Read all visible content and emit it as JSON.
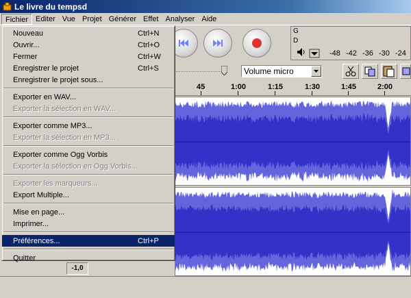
{
  "window": {
    "title": "Le livre du tempsd"
  },
  "menubar": {
    "items": [
      "Fichier",
      "Editer",
      "Vue",
      "Projet",
      "Générer",
      "Effet",
      "Analyser",
      "Aide"
    ]
  },
  "file_menu": {
    "items": [
      {
        "label": "Nouveau",
        "shortcut": "Ctrl+N"
      },
      {
        "label": "Ouvrir...",
        "shortcut": "Ctrl+O"
      },
      {
        "label": "Fermer",
        "shortcut": "Ctrl+W"
      },
      {
        "label": "Enregistrer le projet",
        "shortcut": "Ctrl+S"
      },
      {
        "label": "Enregistrer le projet sous...",
        "shortcut": ""
      },
      {
        "label": "Exporter en WAV...",
        "shortcut": ""
      },
      {
        "label": "Exporter la sélection en WAV...",
        "shortcut": ""
      },
      {
        "label": "Exporter comme MP3...",
        "shortcut": ""
      },
      {
        "label": "Exporter la sélection en MP3...",
        "shortcut": ""
      },
      {
        "label": "Exporter comme Ogg Vorbis",
        "shortcut": ""
      },
      {
        "label": "Exporter la sélection en Ogg Vorbis...",
        "shortcut": ""
      },
      {
        "label": "Exporter les marqueurs...",
        "shortcut": ""
      },
      {
        "label": "Export Multiple...",
        "shortcut": ""
      },
      {
        "label": "Mise en page...",
        "shortcut": ""
      },
      {
        "label": "Imprimer...",
        "shortcut": ""
      },
      {
        "label": "Préférences...",
        "shortcut": "Ctrl+P"
      },
      {
        "label": "Quitter",
        "shortcut": ""
      }
    ]
  },
  "meter": {
    "channel_g": "G",
    "channel_d": "D",
    "ticks": [
      "-48",
      "-42",
      "-36",
      "-30",
      "-24"
    ]
  },
  "volume_select": {
    "value": "Volume micro"
  },
  "ruler": {
    "labels": [
      "45",
      "1:00",
      "1:15",
      "1:30",
      "1:45",
      "2:00"
    ]
  },
  "track": {
    "gain_value": "-1,0"
  },
  "colors": {
    "waveform": "#3232c8",
    "waveform_light": "#6464dc",
    "highlight": "#0a246a"
  }
}
